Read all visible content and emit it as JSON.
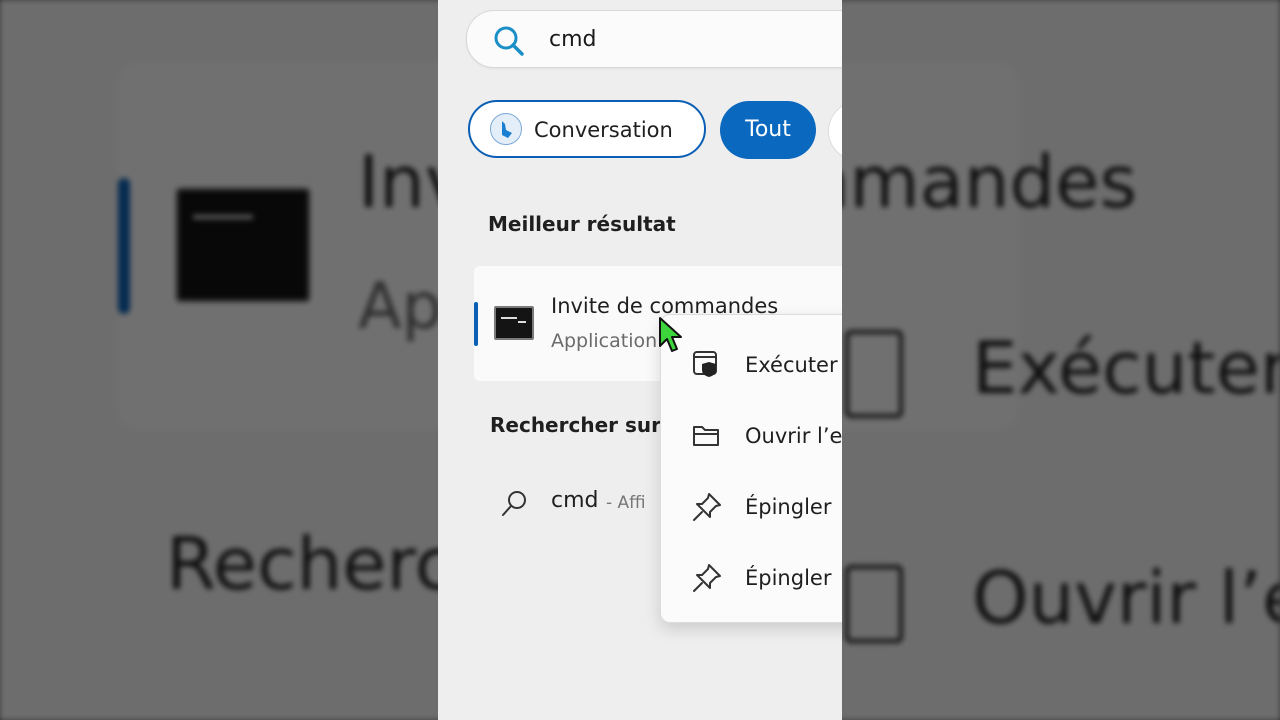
{
  "search": {
    "query": "cmd"
  },
  "filters": {
    "conversation_label": "Conversation",
    "all_label": "Tout"
  },
  "best_match": {
    "section_title": "Meilleur résultat",
    "app_name": "Invite de commandes",
    "app_type": "Application"
  },
  "web_search": {
    "section_title": "Rechercher sur",
    "query": "cmd",
    "hint": "- Affi"
  },
  "context_menu": {
    "items": [
      {
        "label": "Exécuter",
        "icon": "run-as-admin-shield-icon"
      },
      {
        "label": "Ouvrir l’e",
        "icon": "folder-open-icon"
      },
      {
        "label": "Épingler",
        "icon": "pin-icon"
      },
      {
        "label": "Épingler",
        "icon": "pin-icon"
      }
    ]
  },
  "background": {
    "title": "Invite de commandes",
    "subtitle": "Ap",
    "run": "Exécuter",
    "search": "Recherc",
    "open": "Ouvrir l’e"
  },
  "colors": {
    "accent": "#0a5fb4",
    "chip_active": "#0a68bf",
    "cursor": "#3cd63c"
  }
}
